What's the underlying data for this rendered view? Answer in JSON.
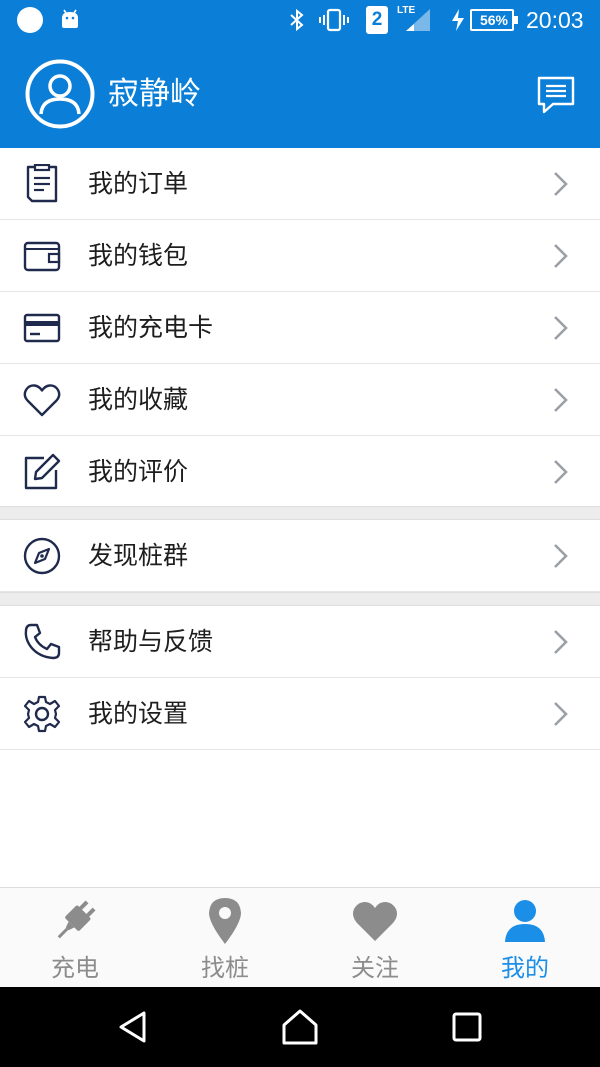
{
  "status_bar": {
    "sim_number": "2",
    "network_type": "LTE",
    "battery": "56%",
    "time": "20:03",
    "icons": [
      "circle-notification-icon",
      "android-icon",
      "bluetooth-icon",
      "vibrate-icon",
      "sim-icon",
      "signal-icon",
      "charging-icon",
      "battery-icon"
    ]
  },
  "header": {
    "username": "寂静岭",
    "avatar_icon": "user-avatar-icon",
    "message_icon": "message-icon"
  },
  "menu": {
    "group1": [
      {
        "label": "我的订单",
        "icon": "order-icon"
      },
      {
        "label": "我的钱包",
        "icon": "wallet-icon"
      },
      {
        "label": "我的充电卡",
        "icon": "card-icon"
      },
      {
        "label": "我的收藏",
        "icon": "heart-icon"
      },
      {
        "label": "我的评价",
        "icon": "edit-icon"
      }
    ],
    "group2": [
      {
        "label": "发现桩群",
        "icon": "compass-icon"
      }
    ],
    "group3": [
      {
        "label": "帮助与反馈",
        "icon": "phone-icon"
      },
      {
        "label": "我的设置",
        "icon": "gear-icon"
      }
    ]
  },
  "tabs": [
    {
      "label": "充电",
      "icon": "plug-icon",
      "active": false
    },
    {
      "label": "找桩",
      "icon": "location-pin-icon",
      "active": false
    },
    {
      "label": "关注",
      "icon": "heart-icon",
      "active": false
    },
    {
      "label": "我的",
      "icon": "person-icon",
      "active": true
    }
  ],
  "colors": {
    "brand_blue": "#0b7fd8",
    "tab_active": "#1b8ee8",
    "tab_inactive": "#8c8c8c",
    "icon_dark": "#1f2a4d"
  },
  "nav_bar": {
    "buttons": [
      "back-icon",
      "home-icon",
      "recents-icon"
    ]
  }
}
